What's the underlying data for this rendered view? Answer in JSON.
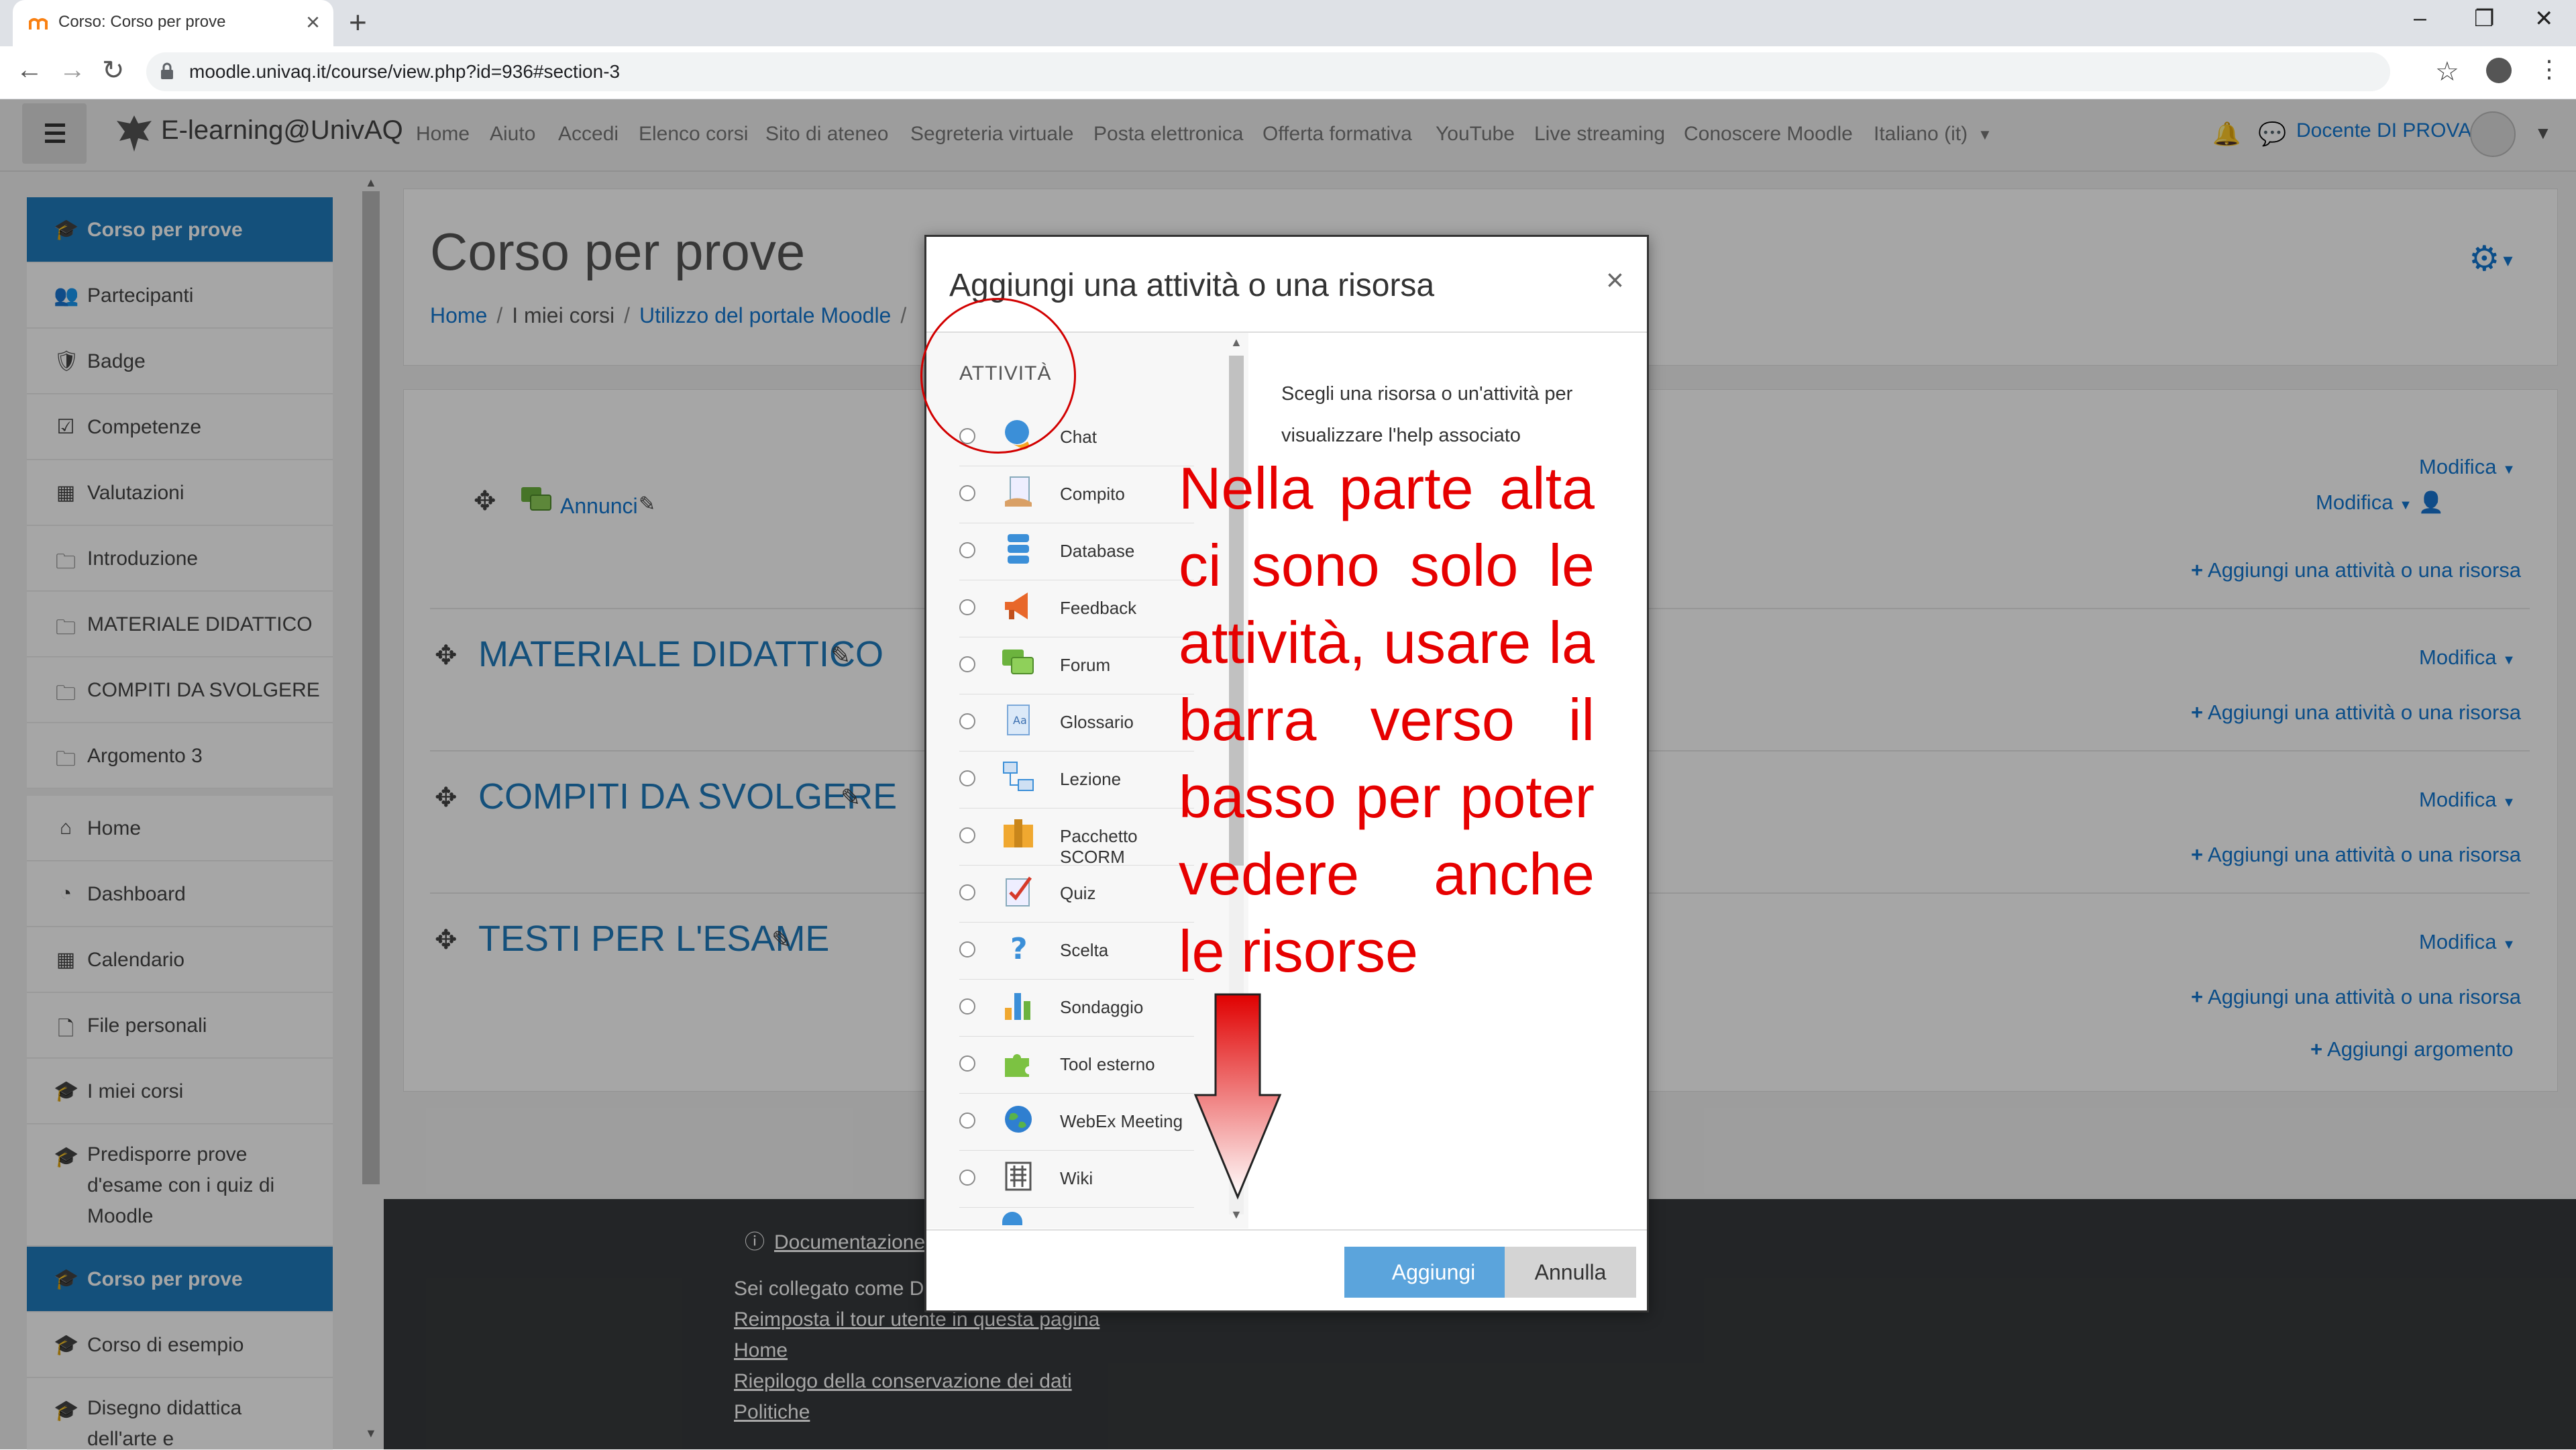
{
  "browser": {
    "tab_title": "Corso: Corso per prove",
    "tab_close": "×",
    "new_tab": "+",
    "url": "moodle.univaq.it/course/view.php?id=936#section-3",
    "window_controls": {
      "minimize": "–",
      "restore": "❐",
      "close": "✕"
    },
    "nav": {
      "back": "←",
      "forward": "→",
      "reload": "↻",
      "star": "☆",
      "menu": "⋮"
    }
  },
  "navbar": {
    "brand": "E-learning@UnivAQ",
    "links": [
      "Home",
      "Aiuto",
      "Accedi",
      "Elenco corsi",
      "Sito di ateneo",
      "Segreteria virtuale",
      "Posta elettronica",
      "Offerta formativa",
      "YouTube",
      "Live streaming",
      "Conoscere Moodle",
      "Italiano (it)"
    ],
    "user": "Docente DI PROVA",
    "icons": [
      "menu-icon",
      "bell-icon",
      "chat-icon",
      "avatar"
    ]
  },
  "sidebar": {
    "items": [
      {
        "label": "Corso per prove",
        "icon": "🎓",
        "active": true
      },
      {
        "label": "Partecipanti",
        "icon": "👥"
      },
      {
        "label": "Badge",
        "icon": "🛡"
      },
      {
        "label": "Competenze",
        "icon": "☑"
      },
      {
        "label": "Valutazioni",
        "icon": "▦"
      },
      {
        "label": "Introduzione",
        "icon": "🗀"
      },
      {
        "label": "MATERIALE DIDATTICO",
        "icon": "🗀"
      },
      {
        "label": "COMPITI DA SVOLGERE",
        "icon": "🗀"
      },
      {
        "label": "Argomento 3",
        "icon": "🗀"
      },
      {
        "label": "Home",
        "icon": "⌂"
      },
      {
        "label": "Dashboard",
        "icon": "◔"
      },
      {
        "label": "Calendario",
        "icon": "▦"
      },
      {
        "label": "File personali",
        "icon": "🗋"
      },
      {
        "label": "I miei corsi",
        "icon": "🎓"
      },
      {
        "label": "Predisporre prove d'esame con i quiz di Moodle",
        "icon": "🎓"
      },
      {
        "label": "Corso per prove",
        "icon": "🎓",
        "active": true
      },
      {
        "label": "Corso di esempio",
        "icon": "🎓"
      },
      {
        "label": "Disegno didattica dell'arte e",
        "icon": "🎓"
      }
    ]
  },
  "page": {
    "title": "Corso per prove",
    "breadcrumb": [
      "Home",
      "I miei corsi",
      "Utilizzo del portale Moodle"
    ],
    "annunci": "Annunci",
    "sections": [
      {
        "title": "MATERIALE DIDATTICO"
      },
      {
        "title": "COMPITI DA SVOLGERE"
      },
      {
        "title": "TESTI PER L'ESAME"
      }
    ],
    "modifica": "Modifica",
    "add_activity": "Aggiungi una attività o una risorsa",
    "add_topic": "Aggiungi argomento"
  },
  "footer": {
    "documentation": "Documentazione",
    "logged_in": "Sei collegato come D",
    "links": [
      "Reimposta il tour utente in questa pagina",
      "Home",
      "Riepilogo della conservazione dei dati",
      "Politiche"
    ]
  },
  "modal": {
    "title": "Aggiungi una attività o una risorsa",
    "close": "×",
    "category": "ATTIVITÀ",
    "options": [
      "Chat",
      "Compito",
      "Database",
      "Feedback",
      "Forum",
      "Glossario",
      "Lezione",
      "Pacchetto SCORM",
      "Quiz",
      "Scelta",
      "Sondaggio",
      "Tool esterno",
      "WebEx Meeting",
      "Wiki"
    ],
    "help": "Scegli una risorsa o un'attività per visualizzare l'help associato",
    "add_button": "Aggiungi",
    "cancel_button": "Annulla"
  },
  "annotation": {
    "text": "Nella parte alta ci sono solo le attività, usare la barra verso il basso per poter vedere anche le risorse",
    "color": "#e60000"
  }
}
